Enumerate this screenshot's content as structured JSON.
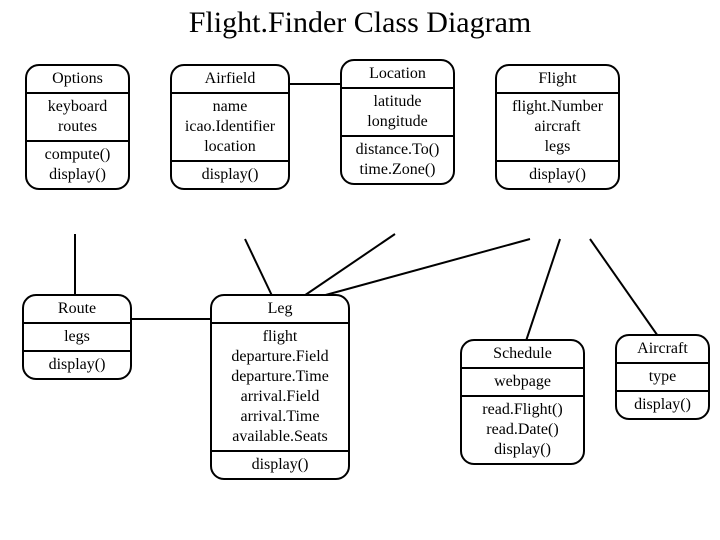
{
  "title": "Flight.Finder Class Diagram",
  "classes": {
    "options": {
      "name": "Options",
      "attrs": [
        "keyboard",
        "routes"
      ],
      "methods": [
        "compute()",
        "display()"
      ]
    },
    "airfield": {
      "name": "Airfield",
      "attrs": [
        "name",
        "icao.Identifier",
        "location"
      ],
      "methods": [
        "display()"
      ]
    },
    "location": {
      "name": "Location",
      "attrs": [
        "latitude",
        "longitude"
      ],
      "methods": [
        "distance.To()",
        "time.Zone()"
      ]
    },
    "flight": {
      "name": "Flight",
      "attrs": [
        "flight.Number",
        "aircraft",
        "legs"
      ],
      "methods": [
        "display()"
      ]
    },
    "route": {
      "name": "Route",
      "attrs": [
        "legs"
      ],
      "methods": [
        "display()"
      ]
    },
    "leg": {
      "name": "Leg",
      "attrs": [
        "flight",
        "departure.Field",
        "departure.Time",
        "arrival.Field",
        "arrival.Time",
        "available.Seats"
      ],
      "methods": [
        "display()"
      ]
    },
    "schedule": {
      "name": "Schedule",
      "attrs": [
        "webpage"
      ],
      "methods": [
        "read.Flight()",
        "read.Date()",
        "display()"
      ]
    },
    "aircraft": {
      "name": "Aircraft",
      "attrs": [
        "type"
      ],
      "methods": [
        "display()"
      ]
    }
  }
}
